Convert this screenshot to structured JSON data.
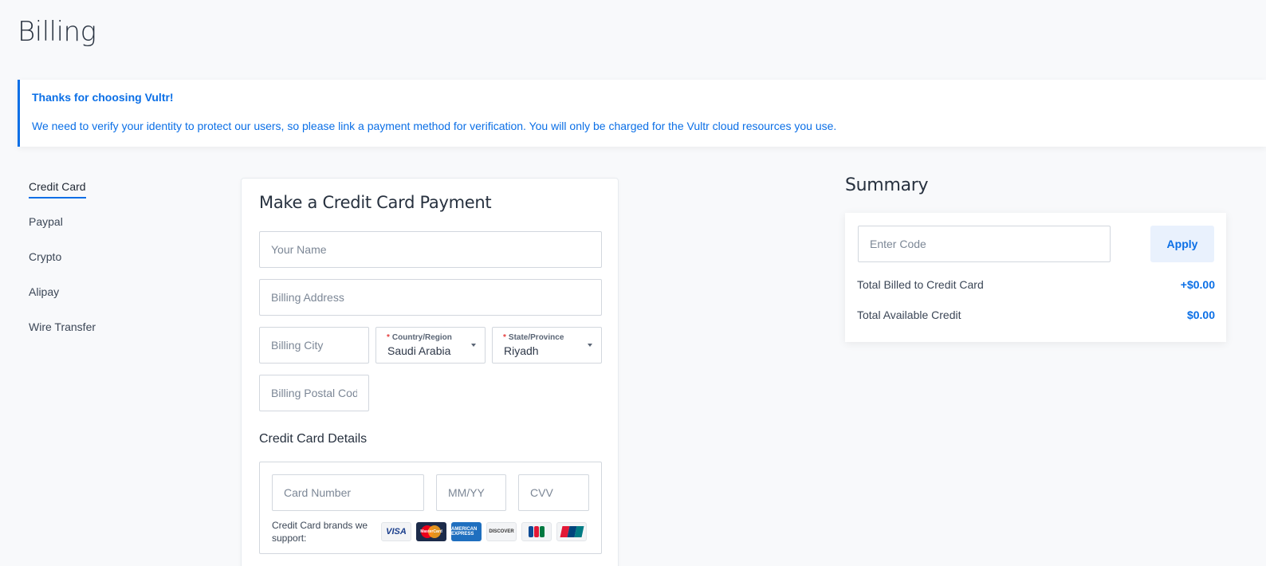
{
  "page": {
    "title": "Billing"
  },
  "notice": {
    "title": "Thanks for choosing Vultr!",
    "body": "We need to verify your identity to protect our users, so please link a payment method for verification. You will only be charged for the Vultr cloud resources you use."
  },
  "side_nav": {
    "items": [
      {
        "label": "Credit Card",
        "active": true
      },
      {
        "label": "Paypal",
        "active": false
      },
      {
        "label": "Crypto",
        "active": false
      },
      {
        "label": "Alipay",
        "active": false
      },
      {
        "label": "Wire Transfer",
        "active": false
      }
    ]
  },
  "payment_form": {
    "title": "Make a Credit Card Payment",
    "name_placeholder": "Your Name",
    "address_placeholder": "Billing Address",
    "city_placeholder": "Billing City",
    "country": {
      "required_mark": "*",
      "label": "Country/Region",
      "value": "Saudi Arabia"
    },
    "state": {
      "required_mark": "*",
      "label": "State/Province",
      "value": "Riyadh"
    },
    "postal_placeholder": "Billing Postal Code",
    "card_details_heading": "Credit Card Details",
    "card_number_placeholder": "Card Number",
    "expiry_placeholder": "MM/YY",
    "cvv_placeholder": "CVV",
    "brands_text": "Credit Card brands we support:",
    "brands": [
      "VISA",
      "MasterCard",
      "AMERICAN EXPRESS",
      "DISCOVER",
      "JCB",
      "UnionPay"
    ]
  },
  "summary": {
    "title": "Summary",
    "code_placeholder": "Enter Code",
    "apply_label": "Apply",
    "rows": [
      {
        "label": "Total Billed to Credit Card",
        "amount": "+$0.00"
      },
      {
        "label": "Total Available Credit",
        "amount": "$0.00"
      }
    ]
  },
  "colors": {
    "accent": "#0b6fe6",
    "required": "#e53e3e"
  }
}
